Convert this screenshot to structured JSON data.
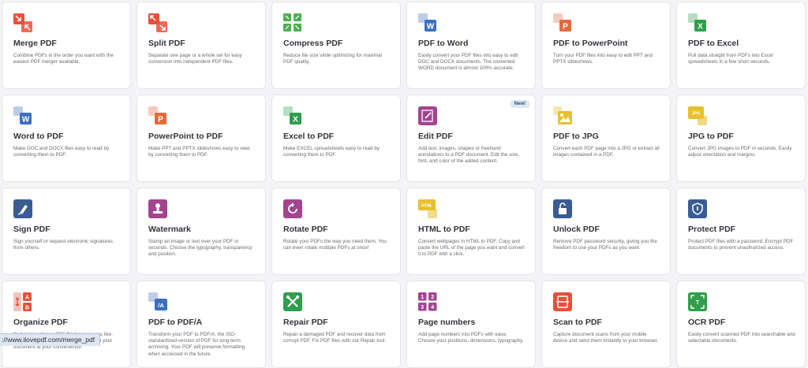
{
  "tools": [
    {
      "id": "merge-pdf",
      "title": "Merge PDF",
      "desc": "Combine PDFs in the order you want with the easiest PDF merger available.",
      "icon": "merge-icon",
      "color": "#e5513a"
    },
    {
      "id": "split-pdf",
      "title": "Split PDF",
      "desc": "Separate one page or a whole set for easy conversion into independent PDF files.",
      "icon": "split-icon",
      "color": "#e5513a"
    },
    {
      "id": "compress-pdf",
      "title": "Compress PDF",
      "desc": "Reduce file size while optimizing for maximal PDF quality.",
      "icon": "compress-icon",
      "color": "#4caf50"
    },
    {
      "id": "pdf-to-word",
      "title": "PDF to Word",
      "desc": "Easily convert your PDF files into easy to edit DOC and DOCX documents. The converted WORD document is almost 100% accurate.",
      "icon": "word-icon",
      "color": "#3d6fbf",
      "letter": "W"
    },
    {
      "id": "pdf-to-powerpoint",
      "title": "PDF to PowerPoint",
      "desc": "Turn your PDF files into easy to edit PPT and PPTX slideshows.",
      "icon": "powerpoint-icon",
      "color": "#e46a3c",
      "letter": "P"
    },
    {
      "id": "pdf-to-excel",
      "title": "PDF to Excel",
      "desc": "Pull data straight from PDFs into Excel spreadsheets in a few short seconds.",
      "icon": "excel-icon",
      "color": "#2f9e4d",
      "letter": "X"
    },
    {
      "id": "word-to-pdf",
      "title": "Word to PDF",
      "desc": "Make DOC and DOCX files easy to read by converting them to PDF.",
      "icon": "word-icon",
      "color": "#3d6fbf",
      "letter": "W"
    },
    {
      "id": "powerpoint-to-pdf",
      "title": "PowerPoint to PDF",
      "desc": "Make PPT and PPTX slideshows easy to view by converting them to PDF.",
      "icon": "powerpoint-icon",
      "color": "#e46a3c",
      "letter": "P"
    },
    {
      "id": "excel-to-pdf",
      "title": "Excel to PDF",
      "desc": "Make EXCEL spreadsheets easy to read by converting them to PDF.",
      "icon": "excel-icon",
      "color": "#2f9e4d",
      "letter": "X"
    },
    {
      "id": "edit-pdf",
      "title": "Edit PDF",
      "desc": "Add text, images, shapes or freehand annotations to a PDF document. Edit the size, font, and color of the added content.",
      "icon": "edit-icon",
      "color": "#a3448f",
      "badge": "New!"
    },
    {
      "id": "pdf-to-jpg",
      "title": "PDF to JPG",
      "desc": "Convert each PDF page into a JPG or extract all images contained in a PDF.",
      "icon": "image-icon",
      "color": "#e6c02e"
    },
    {
      "id": "jpg-to-pdf",
      "title": "JPG to PDF",
      "desc": "Convert JPG images to PDF in seconds. Easily adjust orientation and margins.",
      "icon": "jpg-icon",
      "color": "#e6c02e",
      "letter": "JPG"
    },
    {
      "id": "sign-pdf",
      "title": "Sign PDF",
      "desc": "Sign yourself or request electronic signatures from others.",
      "icon": "pen-icon",
      "color": "#3a5c94"
    },
    {
      "id": "watermark",
      "title": "Watermark",
      "desc": "Stamp an image or text over your PDF in seconds. Choose the typography, transparency and position.",
      "icon": "stamp-icon",
      "color": "#a3448f"
    },
    {
      "id": "rotate-pdf",
      "title": "Rotate PDF",
      "desc": "Rotate your PDFs the way you need them. You can even rotate multiple PDFs at once!",
      "icon": "rotate-icon",
      "color": "#a3448f"
    },
    {
      "id": "html-to-pdf",
      "title": "HTML to PDF",
      "desc": "Convert webpages in HTML to PDF. Copy and paste the URL of the page you want and convert it to PDF with a click.",
      "icon": "html-icon",
      "color": "#e6c02e",
      "letter": "HTML"
    },
    {
      "id": "unlock-pdf",
      "title": "Unlock PDF",
      "desc": "Remove PDF password security, giving you the freedom to use your PDFs as you want.",
      "icon": "unlock-icon",
      "color": "#3a5c94"
    },
    {
      "id": "protect-pdf",
      "title": "Protect PDF",
      "desc": "Protect PDF files with a password. Encrypt PDF documents to prevent unauthorized access.",
      "icon": "shield-icon",
      "color": "#3a5c94"
    },
    {
      "id": "organize-pdf",
      "title": "Organize PDF",
      "desc": "Sort pages of your PDF file however you like. Delete PDF pages or add PDF pages to your document at your convenience.",
      "icon": "organize-icon",
      "color": "#e5513a"
    },
    {
      "id": "pdf-to-pdfa",
      "title": "PDF to PDF/A",
      "desc": "Transform your PDF to PDF/A, the ISO-standardized version of PDF for long-term archiving. Your PDF will preserve formatting when accessed in the future.",
      "icon": "pdfa-icon",
      "color": "#3d6fbf",
      "letter": "/A"
    },
    {
      "id": "repair-pdf",
      "title": "Repair PDF",
      "desc": "Repair a damaged PDF and recover data from corrupt PDF. Fix PDF files with our Repair tool.",
      "icon": "tools-icon",
      "color": "#2f9e4d"
    },
    {
      "id": "page-numbers",
      "title": "Page numbers",
      "desc": "Add page numbers into PDFs with ease. Choose your positions, dimensions, typography.",
      "icon": "numbers-icon",
      "color": "#a3448f"
    },
    {
      "id": "scan-to-pdf",
      "title": "Scan to PDF",
      "desc": "Capture document scans from your mobile device and send them instantly to your browser.",
      "icon": "scan-icon",
      "color": "#e5513a"
    },
    {
      "id": "ocr-pdf",
      "title": "OCR PDF",
      "desc": "Easily convert scanned PDF into searchable and selectable documents.",
      "icon": "ocr-icon",
      "color": "#2f9e4d"
    }
  ],
  "status_url": "://www.ilovepdf.com/merge_pdf"
}
